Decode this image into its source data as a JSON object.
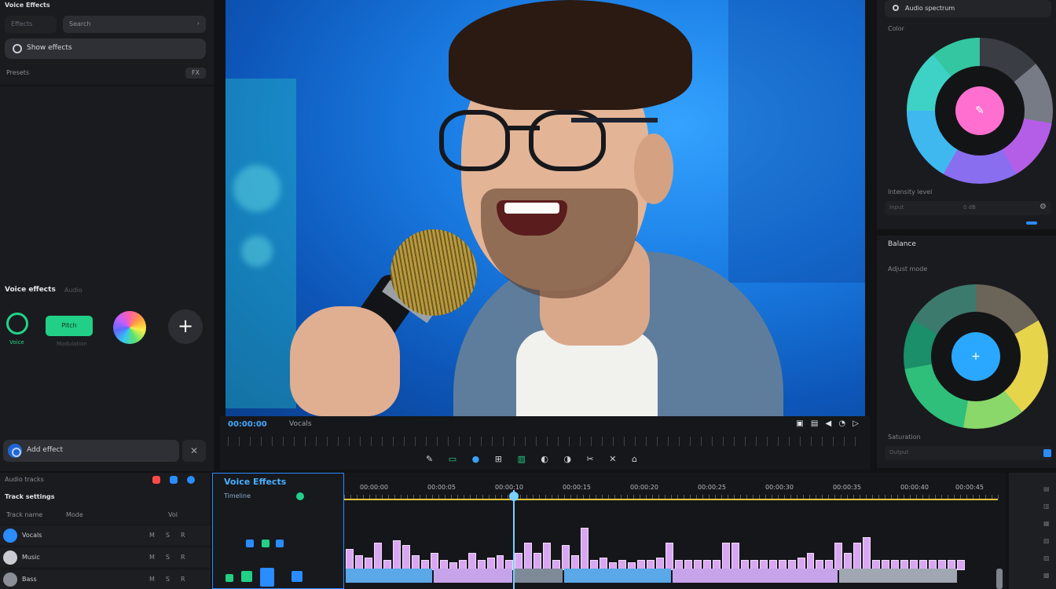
{
  "left_panel": {
    "title": "Voice Effects",
    "tab_label": "Effects",
    "search_label": "Search",
    "pill_label": "Show effects",
    "filter_label": "Presets",
    "filter_button": "FX",
    "section_title": "Voice effects",
    "section_sub": "Audio",
    "tool_a_label": "Voice",
    "tool_b_label": "Pitch",
    "tool_b_caption": "Modulation",
    "add_label": "+",
    "bottom_label": "Add effect",
    "bottom_close": "✕"
  },
  "player": {
    "timecode": "00:00:00",
    "clip_name": "Vocals",
    "right_icons": "▣ ▤ ◀ ◔ ▷",
    "tools_a": "✎ ",
    "tools_g1": "▭ ",
    "tools_b": "● ",
    "tools_c": "⊞ ",
    "tools_g2": "▥ ",
    "tools_d": "◐ ◑ ✂ ✕ ⌂"
  },
  "right_top": {
    "header": "Audio spectrum",
    "label": "Color",
    "caption": "Intensity level",
    "footer": "Input",
    "footer_value": "0 dB",
    "core_icon": "✎"
  },
  "right_bottom": {
    "header": "Balance",
    "label": "Adjust mode",
    "caption": "Saturation",
    "footer": "Output",
    "core_icon": "+"
  },
  "tracks": {
    "header": "Audio tracks",
    "subheader": "Track settings",
    "col_a": "Track name",
    "col_b": "Mode",
    "col_c": "Vol",
    "rows": [
      {
        "name": "Vocals",
        "c1": "M",
        "c2": "S",
        "c3": "R",
        "color": "#2a8cff"
      },
      {
        "name": "Music",
        "c1": "M",
        "c2": "S",
        "c3": "R",
        "color": "#c9ccd2"
      },
      {
        "name": "Bass",
        "c1": "M",
        "c2": "S",
        "c3": "R",
        "color": "#8a8e96"
      }
    ]
  },
  "timeline": {
    "title": "Voice Effects",
    "subtitle": "Timeline",
    "ticks": [
      "00:00:00",
      "00:00:05",
      "00:00:10",
      "00:00:15",
      "00:00:20",
      "00:00:25",
      "00:00:30",
      "00:00:35",
      "00:00:40",
      "00:00:45"
    ],
    "bar_levels": [
      0.42,
      0.3,
      0.25,
      0.55,
      0.2,
      0.6,
      0.5,
      0.3,
      0.2,
      0.35,
      0.2,
      0.15,
      0.2,
      0.35,
      0.2,
      0.25,
      0.3,
      0.2,
      0.35,
      0.55,
      0.35,
      0.55,
      0.2,
      0.5,
      0.3,
      0.85,
      0.2,
      0.25,
      0.15,
      0.2,
      0.15,
      0.2,
      0.2,
      0.25,
      0.55,
      0.2,
      0.2,
      0.2,
      0.2,
      0.2,
      0.55,
      0.55,
      0.2,
      0.2,
      0.2,
      0.2,
      0.2,
      0.2,
      0.25,
      0.35,
      0.2,
      0.2,
      0.55,
      0.35,
      0.55,
      0.65,
      0.2,
      0.2,
      0.2,
      0.2,
      0.2,
      0.2,
      0.2,
      0.2,
      0.2,
      0.2
    ],
    "playhead_position": 0.27
  },
  "right_strip": {
    "items": [
      "▤",
      "▥",
      "▦",
      "▧",
      "▨",
      "▩"
    ]
  },
  "colors": {
    "accent_blue": "#2a8cff",
    "accent_green": "#22cf86",
    "timeline_bar": "#d9a7f2",
    "timeline_marker": "#e7c53a"
  }
}
